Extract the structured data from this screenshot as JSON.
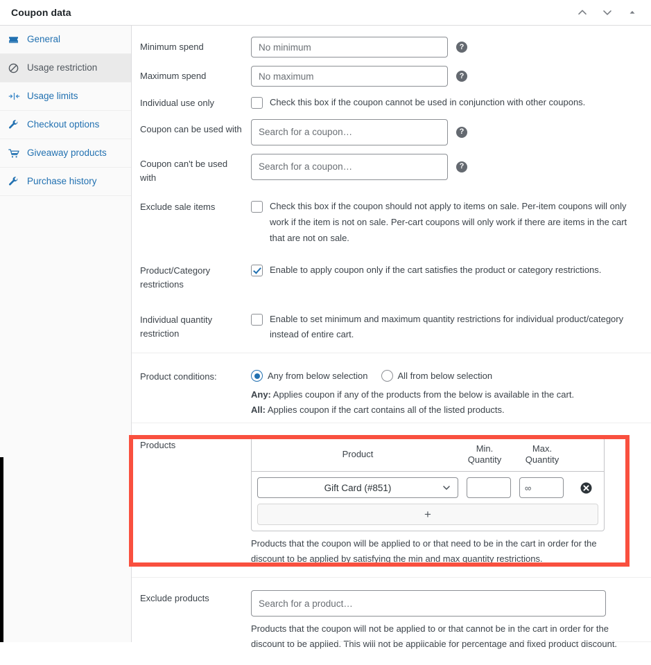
{
  "header": {
    "title": "Coupon data",
    "actions": [
      {
        "name": "move-up-icon",
        "label": "Move up"
      },
      {
        "name": "move-down-icon",
        "label": "Move down"
      },
      {
        "name": "toggle-panel-icon",
        "label": "Toggle panel"
      }
    ]
  },
  "sidebar": {
    "items": [
      {
        "label": "General",
        "icon": "ticket-icon",
        "active": false
      },
      {
        "label": "Usage restriction",
        "icon": "block-icon",
        "active": true
      },
      {
        "label": "Usage limits",
        "icon": "limit-icon",
        "active": false
      },
      {
        "label": "Checkout options",
        "icon": "wrench-icon",
        "active": false
      },
      {
        "label": "Giveaway products",
        "icon": "cart-icon",
        "active": false
      },
      {
        "label": "Purchase history",
        "icon": "wrench-icon",
        "active": false
      }
    ]
  },
  "fields": {
    "minimum_spend": {
      "label": "Minimum spend",
      "value": "",
      "placeholder": "No minimum",
      "help": "?"
    },
    "maximum_spend": {
      "label": "Maximum spend",
      "value": "",
      "placeholder": "No maximum",
      "help": "?"
    },
    "individual_use_only": {
      "label": "Individual use only",
      "checkbox_text": "Check this box if the coupon cannot be used in conjunction with other coupons.",
      "checked": false
    },
    "coupon_can_be_used_with": {
      "label": "Coupon can be used with",
      "value": "",
      "placeholder": "Search for a coupon…",
      "help": "?"
    },
    "coupon_cant_be_used_with": {
      "label": "Coupon can't be used with",
      "value": "",
      "placeholder": "Search for a coupon…",
      "help": "?"
    },
    "exclude_sale_items": {
      "label": "Exclude sale items",
      "checkbox_text": "Check this box if the coupon should not apply to items on sale. Per-item coupons will only work if the item is not on sale. Per-cart coupons will only work if there are items in the cart that are not on sale.",
      "checked": false
    },
    "product_category_restrictions": {
      "label": "Product/Category restrictions",
      "checkbox_text": "Enable to apply coupon only if the cart satisfies the product or category restrictions.",
      "checked": true
    },
    "individual_quantity_restriction": {
      "label": "Individual quantity restriction",
      "checkbox_text": "Enable to set minimum and maximum quantity restrictions for individual product/category instead of entire cart.",
      "checked": false
    },
    "product_conditions": {
      "label": "Product conditions:",
      "options": [
        {
          "label": "Any from below selection",
          "selected": true
        },
        {
          "label": "All from below selection",
          "selected": false
        }
      ],
      "help_any_bold": "Any:",
      "help_any_text": " Applies coupon if any of the products from the below is available in the cart.",
      "help_all_bold": "All:",
      "help_all_text": " Applies coupon if the cart contains all of the listed products."
    },
    "products": {
      "label": "Products",
      "columns": [
        "Product",
        "Min. Quantity",
        "Max. Quantity"
      ],
      "rows": [
        {
          "product": "Gift Card (#851)",
          "min_quantity": "",
          "min_quantity_placeholder": "",
          "max_quantity": "",
          "max_quantity_placeholder": "∞",
          "delete_icon": "delete-circle-icon"
        }
      ],
      "add_row_label": "+",
      "description": "Products that the coupon will be applied to or that need to be in the cart in order for the discount to be applied by satisfying the min and max quantity restrictions."
    },
    "exclude_products": {
      "label": "Exclude products",
      "value": "",
      "placeholder": "Search for a product…",
      "description": "Products that the coupon will not be applied to or that cannot be in the cart in order for the discount to be applied. This will not be applicable for percentage and fixed product discount."
    }
  },
  "colors": {
    "link": "#2271b1",
    "highlight": "#f9503f",
    "active_bg": "#eaeaea",
    "border": "#c3c4c7",
    "text": "#3c434a"
  }
}
